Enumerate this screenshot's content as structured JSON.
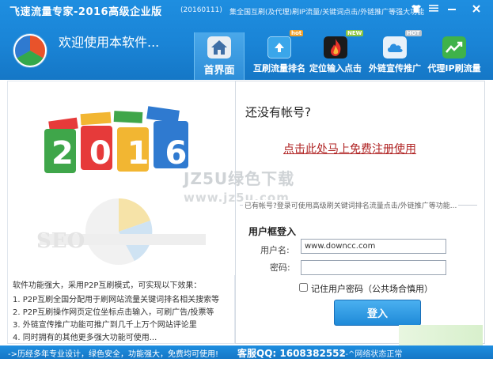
{
  "window": {
    "app_title": "飞速流量专家-2016高级企业版",
    "version": "(20160111)",
    "description": "集全国互刷(及代理)刷IP流量/关键词点击/外链推广等强大功能",
    "controls": {
      "skin_icon": "shirt-icon",
      "menu_icon": "menu-icon",
      "minimize_icon": "minimize-icon",
      "close_icon": "close-icon"
    }
  },
  "header": {
    "welcome": "欢迎使用本软件...",
    "nav": [
      {
        "label": "首界面",
        "icon": "house-icon"
      },
      {
        "label": "互刷流量排名",
        "icon": "upload-icon",
        "badge": "hot"
      },
      {
        "label": "定位输入点击",
        "icon": "fire-icon",
        "badge": "NEW"
      },
      {
        "label": "外链宣传推广",
        "icon": "cloud-icon",
        "badge": "HOT"
      },
      {
        "label": "代理IP刷流量",
        "icon": "trend-icon"
      }
    ]
  },
  "banner": {
    "year": "2016"
  },
  "features": {
    "intro": "软件功能强大，采用P2P互刷模式，可实现以下效果：",
    "items": [
      "1. P2P互刷全国分配用于刷网站流量关键词排名相关搜索等",
      "2. P2P互刷操作网页定位坐标点击输入，可刷广告/投票等",
      "3. 外链宣传推广功能可推广到几千上万个网站评论里",
      "4. 同时拥有的其他更多强大功能可使用..."
    ]
  },
  "account": {
    "no_account": "还没有帐号?",
    "register_link": "点击此处马上免费注册使用"
  },
  "watermark": {
    "line1": "JZ5U绿色下载",
    "line2": "www.jz5u.com"
  },
  "login": {
    "group_caption": "已有帐号?登录可使用高级刷关键词排名流量点击/外链推广等功能...",
    "title": "用户框登入",
    "username_label": "用户名:",
    "username_value": "www.downcc.com",
    "password_label": "密码:",
    "password_value": "",
    "remember_label": "记住用户密码（公共场合慎用）",
    "login_button": "登入"
  },
  "statusbar": {
    "left": "->历经多年专业设计，绿色安全，功能强大，免费均可使用!",
    "qq": "客服QQ: 1608382552",
    "right": "^-^网络状态正常"
  },
  "colors": {
    "header_blue": "#1a84d6",
    "register_red": "#b02424",
    "login_blue": "#1f8ad8"
  }
}
